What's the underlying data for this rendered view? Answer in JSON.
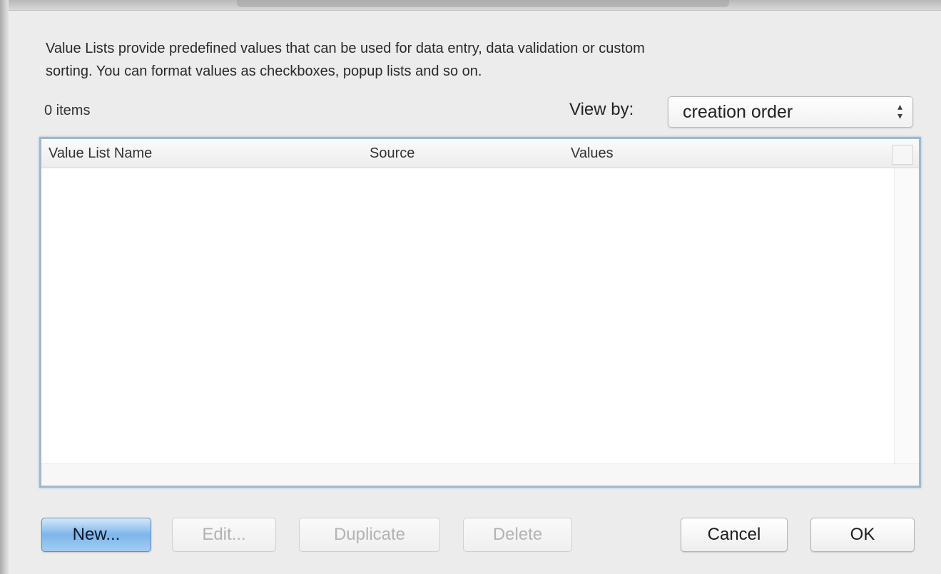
{
  "description": {
    "line1": "Value Lists provide predefined values that can be used for data entry, data validation or custom",
    "line2": "sorting. You can format values as checkboxes, popup lists and so on."
  },
  "items_count": "0 items",
  "view_by": {
    "label": "View by:",
    "selected": "creation order"
  },
  "table": {
    "columns": [
      "Value List Name",
      "Source",
      "Values"
    ],
    "rows": []
  },
  "buttons": {
    "new": "New...",
    "edit": "Edit...",
    "duplicate": "Duplicate",
    "delete": "Delete",
    "cancel": "Cancel",
    "ok": "OK"
  }
}
